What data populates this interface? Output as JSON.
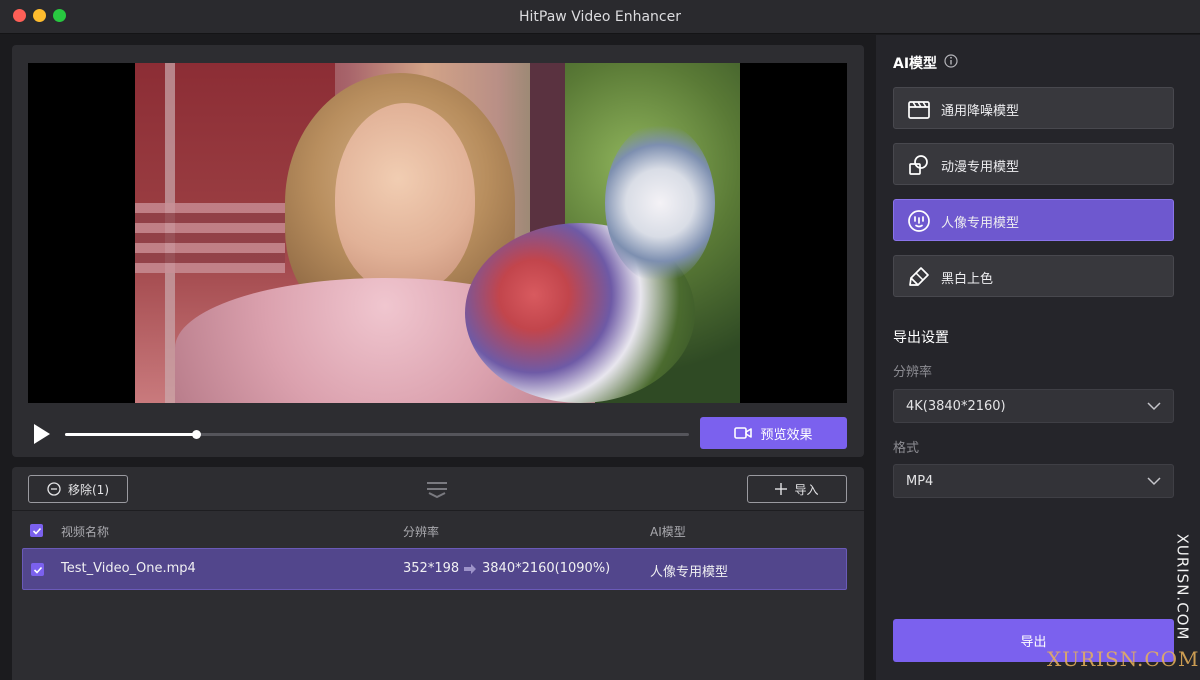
{
  "window": {
    "title": "HitPaw Video Enhancer"
  },
  "player": {
    "progress_fraction": 0.21,
    "preview_label": "预览效果"
  },
  "list": {
    "remove_label": "移除(1)",
    "import_label": "导入",
    "headers": {
      "name": "视频名称",
      "resolution": "分辨率",
      "model": "AI模型"
    },
    "rows": [
      {
        "name": "Test_Video_One.mp4",
        "from_res": "352*198",
        "to_res": "3840*2160(1090%)",
        "model": "人像专用模型",
        "checked": true
      }
    ]
  },
  "sidebar": {
    "ai_title": "AI模型",
    "models": [
      {
        "label": "通用降噪模型",
        "icon": "clapperboard-icon",
        "active": false
      },
      {
        "label": "动漫专用模型",
        "icon": "anime-shapes-icon",
        "active": false
      },
      {
        "label": "人像专用模型",
        "icon": "portrait-face-icon",
        "active": true
      },
      {
        "label": "黑白上色",
        "icon": "paint-eraser-icon",
        "active": false
      }
    ],
    "export_title": "导出设置",
    "resolution_label": "分辨率",
    "resolution_value": "4K(3840*2160)",
    "format_label": "格式",
    "format_value": "MP4",
    "export_label": "导出"
  },
  "watermark": {
    "vertical": "XURISN.COM",
    "horizontal": "XURISN.COM"
  },
  "colors": {
    "accent": "#7b61ee",
    "active_model": "#6e58cf",
    "selected_row": "#52468c",
    "panel": "#2d2d31",
    "sidebar": "#25252a"
  }
}
